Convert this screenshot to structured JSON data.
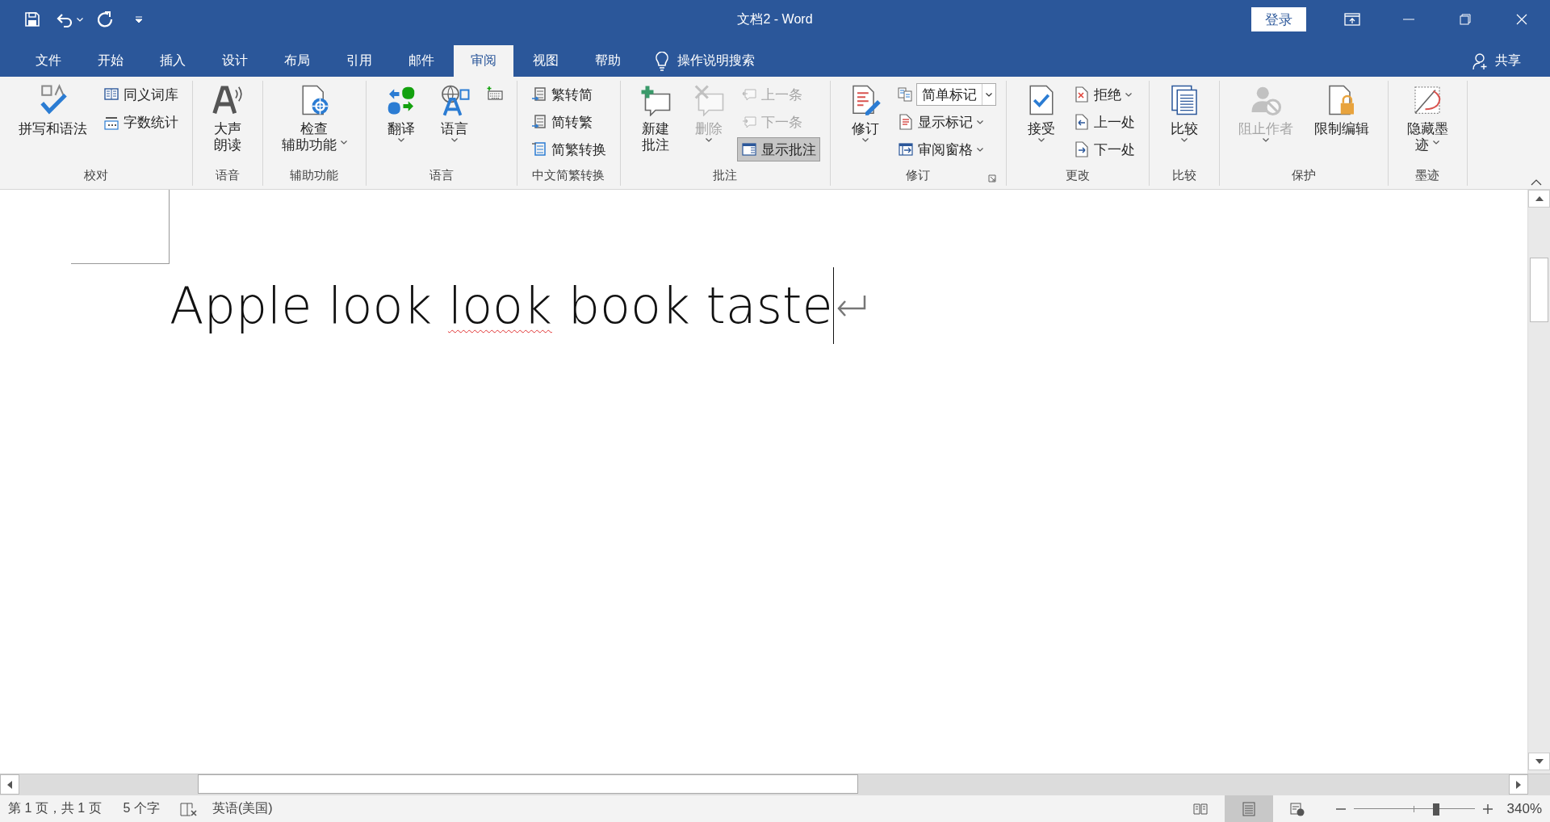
{
  "title_bar": {
    "title": "文档2 - Word",
    "login": "登录"
  },
  "tabs": [
    {
      "label": "文件",
      "selected": false
    },
    {
      "label": "开始",
      "selected": false
    },
    {
      "label": "插入",
      "selected": false
    },
    {
      "label": "设计",
      "selected": false
    },
    {
      "label": "布局",
      "selected": false
    },
    {
      "label": "引用",
      "selected": false
    },
    {
      "label": "邮件",
      "selected": false
    },
    {
      "label": "审阅",
      "selected": true
    },
    {
      "label": "视图",
      "selected": false
    },
    {
      "label": "帮助",
      "selected": false
    }
  ],
  "search": {
    "placeholder": "操作说明搜索"
  },
  "share": "共享",
  "ribbon": {
    "groups": [
      {
        "label": "校对",
        "dialog_launcher": false,
        "items": [
          {
            "kind": "large",
            "lines": [
              "拼写和语法"
            ],
            "dropdown": false,
            "disabled": false
          },
          {
            "kind": "stack",
            "items": [
              {
                "kind": "small",
                "label": "同义词库",
                "dropdown": false,
                "disabled": false,
                "pressed": false
              },
              {
                "kind": "small",
                "label": "字数统计",
                "dropdown": false,
                "disabled": false,
                "pressed": false
              }
            ]
          }
        ]
      },
      {
        "label": "语音",
        "dialog_launcher": false,
        "items": [
          {
            "kind": "large",
            "lines": [
              "大声",
              "朗读"
            ],
            "dropdown": false,
            "disabled": false
          }
        ]
      },
      {
        "label": "辅助功能",
        "dialog_launcher": false,
        "items": [
          {
            "kind": "large",
            "lines": [
              "检查",
              "辅助功能"
            ],
            "dropdown": true,
            "disabled": false
          }
        ]
      },
      {
        "label": "语言",
        "dialog_launcher": false,
        "items": [
          {
            "kind": "large",
            "lines": [
              "翻译"
            ],
            "dropdown": true,
            "disabled": false
          },
          {
            "kind": "large",
            "lines": [
              "语言"
            ],
            "dropdown": true,
            "disabled": false
          },
          {
            "kind": "stack",
            "items": [
              {
                "kind": "icon",
                "disabled": false
              }
            ]
          }
        ]
      },
      {
        "label": "中文简繁转换",
        "dialog_launcher": false,
        "items": [
          {
            "kind": "stack",
            "items": [
              {
                "kind": "small",
                "label": "繁转简",
                "dropdown": false,
                "disabled": false,
                "pressed": false
              },
              {
                "kind": "small",
                "label": "简转繁",
                "dropdown": false,
                "disabled": false,
                "pressed": false
              },
              {
                "kind": "small",
                "label": "简繁转换",
                "dropdown": false,
                "disabled": false,
                "pressed": false
              }
            ]
          }
        ]
      },
      {
        "label": "批注",
        "dialog_launcher": false,
        "items": [
          {
            "kind": "large",
            "lines": [
              "新建",
              "批注"
            ],
            "dropdown": false,
            "disabled": false
          },
          {
            "kind": "large",
            "lines": [
              "删除"
            ],
            "dropdown": true,
            "disabled": true
          },
          {
            "kind": "stack",
            "items": [
              {
                "kind": "small",
                "label": "上一条",
                "dropdown": false,
                "disabled": true,
                "pressed": false
              },
              {
                "kind": "small",
                "label": "下一条",
                "dropdown": false,
                "disabled": true,
                "pressed": false
              },
              {
                "kind": "small",
                "label": "显示批注",
                "dropdown": false,
                "disabled": false,
                "pressed": true
              }
            ]
          }
        ]
      },
      {
        "label": "修订",
        "dialog_launcher": true,
        "items": [
          {
            "kind": "large",
            "lines": [
              "修订"
            ],
            "dropdown": true,
            "disabled": false
          },
          {
            "kind": "stack",
            "items": [
              {
                "kind": "combo",
                "value": "简单标记"
              },
              {
                "kind": "small",
                "label": "显示标记",
                "dropdown": true,
                "disabled": false,
                "pressed": false
              },
              {
                "kind": "small",
                "label": "审阅窗格",
                "dropdown": true,
                "disabled": false,
                "pressed": false
              }
            ]
          }
        ]
      },
      {
        "label": "更改",
        "dialog_launcher": false,
        "items": [
          {
            "kind": "large",
            "lines": [
              "接受"
            ],
            "dropdown": true,
            "disabled": false
          },
          {
            "kind": "stack",
            "items": [
              {
                "kind": "small",
                "label": "拒绝",
                "dropdown": true,
                "disabled": false,
                "pressed": false
              },
              {
                "kind": "small",
                "label": "上一处",
                "dropdown": false,
                "disabled": false,
                "pressed": false
              },
              {
                "kind": "small",
                "label": "下一处",
                "dropdown": false,
                "disabled": false,
                "pressed": false
              }
            ]
          }
        ]
      },
      {
        "label": "比较",
        "dialog_launcher": false,
        "items": [
          {
            "kind": "large",
            "lines": [
              "比较"
            ],
            "dropdown": true,
            "disabled": false
          }
        ]
      },
      {
        "label": "保护",
        "dialog_launcher": false,
        "items": [
          {
            "kind": "large",
            "lines": [
              "阻止作者"
            ],
            "dropdown": true,
            "disabled": true
          },
          {
            "kind": "large",
            "lines": [
              "限制编辑"
            ],
            "dropdown": false,
            "disabled": false
          }
        ]
      },
      {
        "label": "墨迹",
        "dialog_launcher": false,
        "items": [
          {
            "kind": "large",
            "lines": [
              "隐藏墨",
              "迹"
            ],
            "dropdown": true,
            "disabled": false
          }
        ]
      }
    ]
  },
  "document": {
    "words": [
      {
        "text": "Apple",
        "misspelled": false
      },
      {
        "text": "look",
        "misspelled": false
      },
      {
        "text": "look",
        "misspelled": true
      },
      {
        "text": "book",
        "misspelled": false
      },
      {
        "text": "taste",
        "misspelled": false
      }
    ]
  },
  "status_bar": {
    "page": "第 1 页，共 1 页",
    "word_count": "5 个字",
    "language": "英语(美国)",
    "views": [
      {
        "selected": false
      },
      {
        "selected": true
      },
      {
        "selected": false
      }
    ],
    "zoom": {
      "level": 0.68,
      "reading": "340%"
    }
  }
}
